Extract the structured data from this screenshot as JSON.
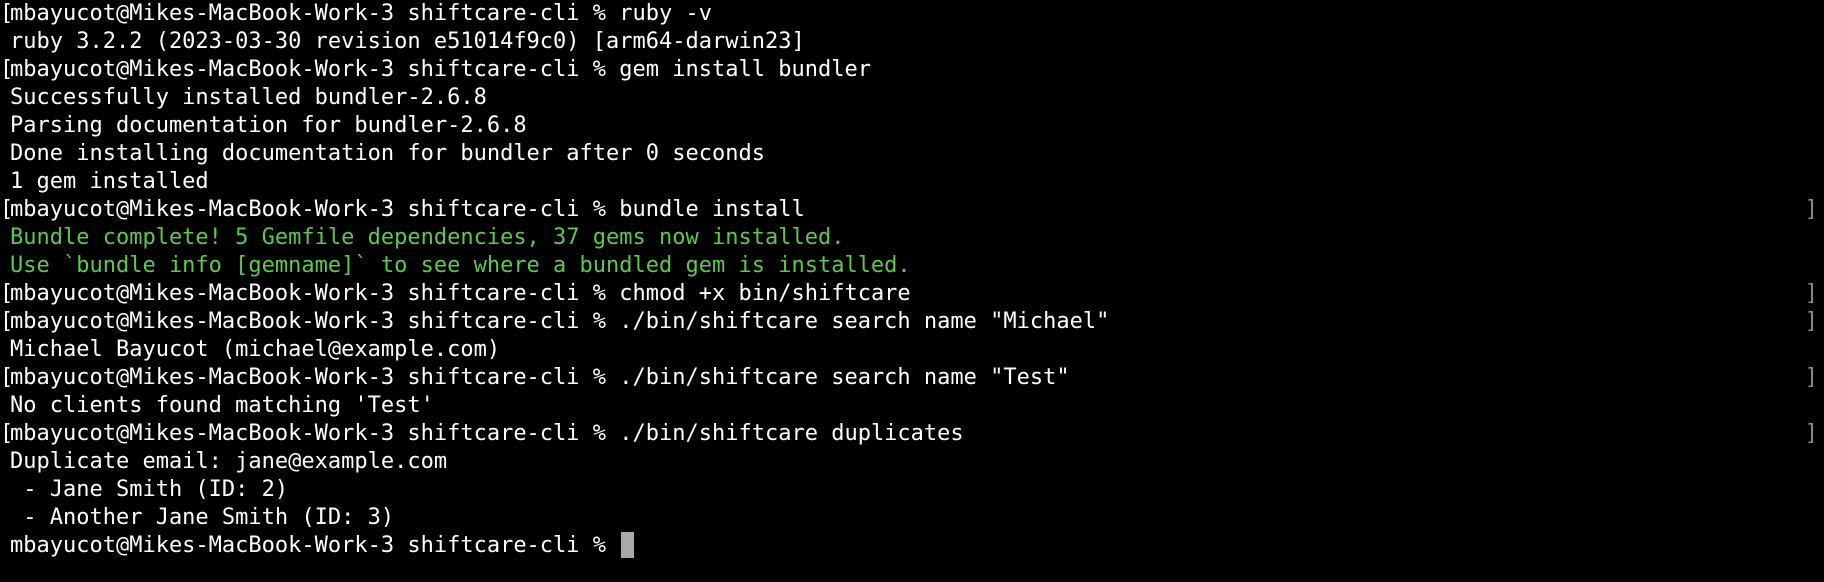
{
  "terminal": {
    "lines": [
      {
        "kind": "prompt",
        "prompt": "mbayucot@Mikes-MacBook-Work-3 shiftcare-cli %",
        "command": "ruby -v",
        "bracket": false
      },
      {
        "kind": "output",
        "text": "ruby 3.2.2 (2023-03-30 revision e51014f9c0) [arm64-darwin23]"
      },
      {
        "kind": "prompt",
        "prompt": "mbayucot@Mikes-MacBook-Work-3 shiftcare-cli %",
        "command": "gem install bundler",
        "bracket": false
      },
      {
        "kind": "output",
        "text": "Successfully installed bundler-2.6.8"
      },
      {
        "kind": "output",
        "text": "Parsing documentation for bundler-2.6.8"
      },
      {
        "kind": "output",
        "text": "Done installing documentation for bundler after 0 seconds"
      },
      {
        "kind": "output",
        "text": "1 gem installed"
      },
      {
        "kind": "prompt",
        "prompt": "mbayucot@Mikes-MacBook-Work-3 shiftcare-cli %",
        "command": "bundle install",
        "bracket": true
      },
      {
        "kind": "output-green",
        "text": "Bundle complete! 5 Gemfile dependencies, 37 gems now installed."
      },
      {
        "kind": "output-green",
        "text": "Use `bundle info [gemname]` to see where a bundled gem is installed."
      },
      {
        "kind": "prompt",
        "prompt": "mbayucot@Mikes-MacBook-Work-3 shiftcare-cli %",
        "command": "chmod +x bin/shiftcare",
        "bracket": true
      },
      {
        "kind": "prompt",
        "prompt": "mbayucot@Mikes-MacBook-Work-3 shiftcare-cli %",
        "command": "./bin/shiftcare search name \"Michael\"",
        "bracket": true
      },
      {
        "kind": "output",
        "text": "Michael Bayucot (michael@example.com)"
      },
      {
        "kind": "prompt",
        "prompt": "mbayucot@Mikes-MacBook-Work-3 shiftcare-cli %",
        "command": "./bin/shiftcare search name \"Test\"",
        "bracket": true
      },
      {
        "kind": "output",
        "text": "No clients found matching 'Test'"
      },
      {
        "kind": "prompt",
        "prompt": "mbayucot@Mikes-MacBook-Work-3 shiftcare-cli %",
        "command": "./bin/shiftcare duplicates",
        "bracket": true
      },
      {
        "kind": "output",
        "text": "Duplicate email: jane@example.com"
      },
      {
        "kind": "output",
        "text": " - Jane Smith (ID: 2)"
      },
      {
        "kind": "output",
        "text": " - Another Jane Smith (ID: 3)"
      }
    ],
    "current_prompt": "mbayucot@Mikes-MacBook-Work-3 shiftcare-cli %",
    "colors": {
      "background": "#000000",
      "text": "#ffffff",
      "success_green": "#5ec84e",
      "cursor": "#a8a8a8"
    }
  }
}
